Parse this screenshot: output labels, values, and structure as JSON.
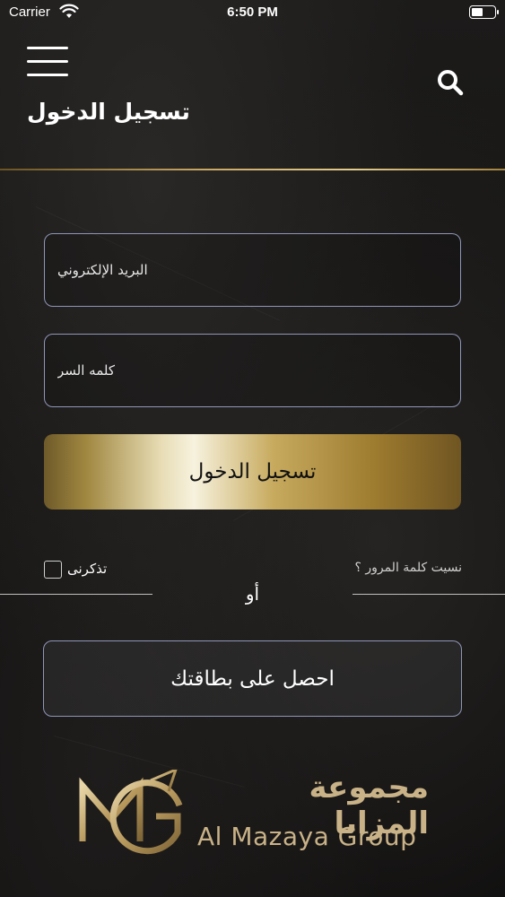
{
  "status_bar": {
    "carrier": "Carrier",
    "time": "6:50 PM"
  },
  "header": {
    "title": "تسجيل الدخول"
  },
  "form": {
    "email_placeholder": "البريد الإلكتروني",
    "password_placeholder": "كلمه السر",
    "login_label": "تسجيل الدخول",
    "remember_label": "تذكرنى",
    "forgot_label": "نسيت كلمة المرور ؟",
    "or_label": "أو",
    "get_card_label": "احصل على بطاقتك"
  },
  "logo": {
    "arabic": "مجموعة المزايا",
    "english": "Al Mazaya Group"
  },
  "colors": {
    "gold": "#c9a862",
    "field_border": "#8e96b8",
    "background": "#161514"
  },
  "icons": [
    "wifi-icon",
    "battery-icon",
    "menu-icon",
    "search-icon",
    "checkbox"
  ]
}
